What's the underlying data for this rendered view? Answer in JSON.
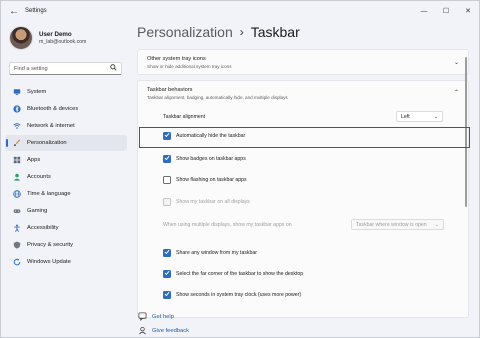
{
  "window": {
    "title": "Settings",
    "minimize": "—",
    "maximize": "☐",
    "close": "✕"
  },
  "user": {
    "name": "User Demo",
    "email": "m_lab@outlook.com"
  },
  "search": {
    "placeholder": "Find a setting"
  },
  "nav": [
    {
      "label": "System",
      "icon": "system-icon",
      "color": "#2f6bbf",
      "active": false
    },
    {
      "label": "Bluetooth & devices",
      "icon": "bluetooth-icon",
      "color": "#2f6bbf",
      "active": false
    },
    {
      "label": "Network & internet",
      "icon": "network-icon",
      "color": "#2f6bbf",
      "active": false
    },
    {
      "label": "Personalization",
      "icon": "brush-icon",
      "color": "#c98a2a",
      "active": true
    },
    {
      "label": "Apps",
      "icon": "apps-icon",
      "color": "#5a6b80",
      "active": false
    },
    {
      "label": "Accounts",
      "icon": "person-icon",
      "color": "#2fa36b",
      "active": false
    },
    {
      "label": "Time & language",
      "icon": "globe-icon",
      "color": "#2f6bbf",
      "active": false
    },
    {
      "label": "Gaming",
      "icon": "gamepad-icon",
      "color": "#6f7780",
      "active": false
    },
    {
      "label": "Accessibility",
      "icon": "accessibility-icon",
      "color": "#2f6bbf",
      "active": false
    },
    {
      "label": "Privacy & security",
      "icon": "shield-icon",
      "color": "#6f7780",
      "active": false
    },
    {
      "label": "Windows Update",
      "icon": "update-icon",
      "color": "#2f6bbf",
      "active": false
    }
  ],
  "breadcrumb": {
    "parent": "Personalization",
    "separator": "›",
    "current": "Taskbar"
  },
  "tray_card": {
    "title": "Other system tray icons",
    "subtitle": "Show or hide additional system tray icons"
  },
  "behaviors": {
    "title": "Taskbar behaviors",
    "subtitle": "Taskbar alignment, badging, automatically hide, and multiple displays",
    "alignment_label": "Taskbar alignment",
    "alignment_value": "Left",
    "multi_display_label": "When using multiple displays, show my taskbar apps on",
    "multi_display_value": "Taskbar where window is open",
    "options": [
      {
        "label": "Automatically hide the taskbar",
        "state": "checked"
      },
      {
        "label": "Show badges on taskbar apps",
        "state": "checked"
      },
      {
        "label": "Show flashing on taskbar apps",
        "state": "unchecked"
      },
      {
        "label": "Show my taskbar on all displays",
        "state": "disabled"
      },
      {
        "label": "Share any window from my taskbar",
        "state": "checked"
      },
      {
        "label": "Select the far corner of the taskbar to show the desktop",
        "state": "checked"
      },
      {
        "label": "Show seconds in system tray clock (uses more power)",
        "state": "checked"
      }
    ]
  },
  "footer": {
    "help": "Get help",
    "feedback": "Give feedback"
  },
  "colors": {
    "accent": "#2f6bbf",
    "highlight": "#c4232f"
  }
}
